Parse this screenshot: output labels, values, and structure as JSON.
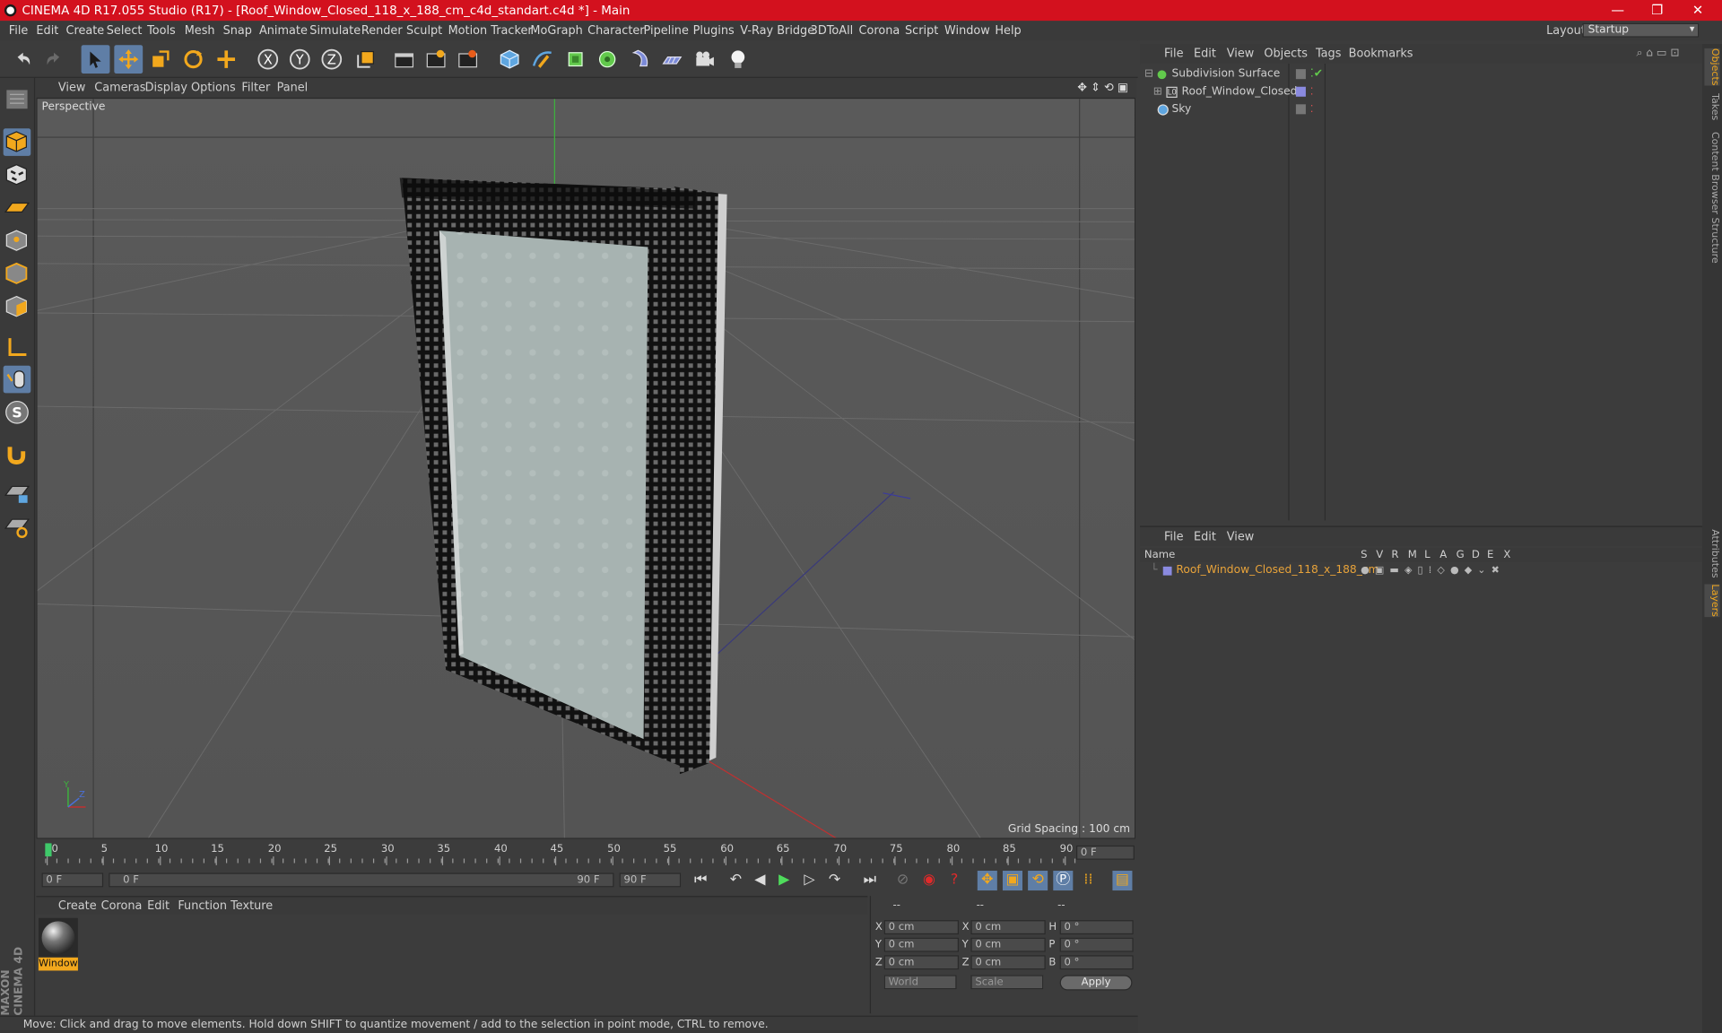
{
  "app": {
    "title": "CINEMA 4D R17.055 Studio (R17) - [Roof_Window_Closed_118_x_188_cm_c4d_standart.c4d *] - Main",
    "window_controls": [
      "—",
      "❐",
      "✕"
    ]
  },
  "menubar": {
    "items": [
      "File",
      "Edit",
      "Create",
      "Select",
      "Tools",
      "Mesh",
      "Snap",
      "Animate",
      "Simulate",
      "Render",
      "Sculpt",
      "Motion Tracker",
      "MoGraph",
      "Character",
      "Pipeline",
      "Plugins",
      "V-Ray Bridge",
      "3DToAll",
      "Corona",
      "Script",
      "Window",
      "Help"
    ],
    "layout_label": "Layout:",
    "layout_value": "Startup"
  },
  "toolbar": {
    "icons": [
      "undo-icon",
      "redo-icon",
      "live-selection-icon",
      "move-icon",
      "scale-icon",
      "rotate-icon",
      "transform-icon",
      "x-axis-icon",
      "y-axis-icon",
      "z-axis-icon",
      "coordinate-system-icon",
      "render-view-icon",
      "render-picture-viewer-icon",
      "edit-render-settings-icon",
      "cube-icon",
      "pen-spline-icon",
      "subdivision-icon",
      "cloner-icon",
      "deformer-icon",
      "floor-icon",
      "camera-icon",
      "light-icon"
    ]
  },
  "viewport": {
    "menu": [
      "View",
      "Cameras",
      "Display",
      "Options",
      "Filter",
      "Panel"
    ],
    "label": "Perspective",
    "grid_spacing": "Grid Spacing : 100 cm"
  },
  "timeline": {
    "ticks": [
      "0",
      "5",
      "10",
      "15",
      "20",
      "25",
      "30",
      "35",
      "40",
      "45",
      "50",
      "55",
      "60",
      "65",
      "70",
      "75",
      "80",
      "85",
      "90"
    ],
    "current_frame": "0 F",
    "start_frame": "0 F",
    "range_start": "0 F",
    "range_end": "90 F",
    "end_frame": "90 F"
  },
  "material_manager": {
    "menu": [
      "Create",
      "Corona",
      "Edit",
      "Function",
      "Texture"
    ],
    "material_name": "Window"
  },
  "coord_manager": {
    "headers": [
      "--",
      "--",
      "--"
    ],
    "rows": [
      {
        "a": "X",
        "av": "0 cm",
        "b": "X",
        "bv": "0 cm",
        "c": "H",
        "cv": "0 °"
      },
      {
        "a": "Y",
        "av": "0 cm",
        "b": "Y",
        "bv": "0 cm",
        "c": "P",
        "cv": "0 °"
      },
      {
        "a": "Z",
        "av": "0 cm",
        "b": "Z",
        "bv": "0 cm",
        "c": "B",
        "cv": "0 °"
      }
    ],
    "world": "World",
    "scale": "Scale",
    "apply": "Apply"
  },
  "object_manager": {
    "menu": [
      "File",
      "Edit",
      "View",
      "Objects",
      "Tags",
      "Bookmarks"
    ],
    "objects": [
      "Subdivision Surface",
      "Roof_Window_Closed",
      "Sky"
    ]
  },
  "layer_manager": {
    "menu": [
      "File",
      "Edit",
      "View"
    ],
    "columns": [
      "Name",
      "S",
      "V",
      "R",
      "M",
      "L",
      "A",
      "G",
      "D",
      "E",
      "X"
    ],
    "layer_name": "Roof_Window_Closed_118_x_188_cm"
  },
  "right_tabs": [
    "Objects",
    "Takes",
    "Content Browser",
    "Structure",
    "Attributes",
    "Layers"
  ],
  "status": "Move: Click and drag to move elements. Hold down SHIFT to quantize movement / add to the selection in point mode, CTRL to remove.",
  "brand": "MAXON CINEMA 4D",
  "colors": {
    "title_bar": "#d3111e",
    "selected": "#5f7ea6",
    "layer_orange": "#e8a33a",
    "layer_color": "#8a8ae0"
  }
}
